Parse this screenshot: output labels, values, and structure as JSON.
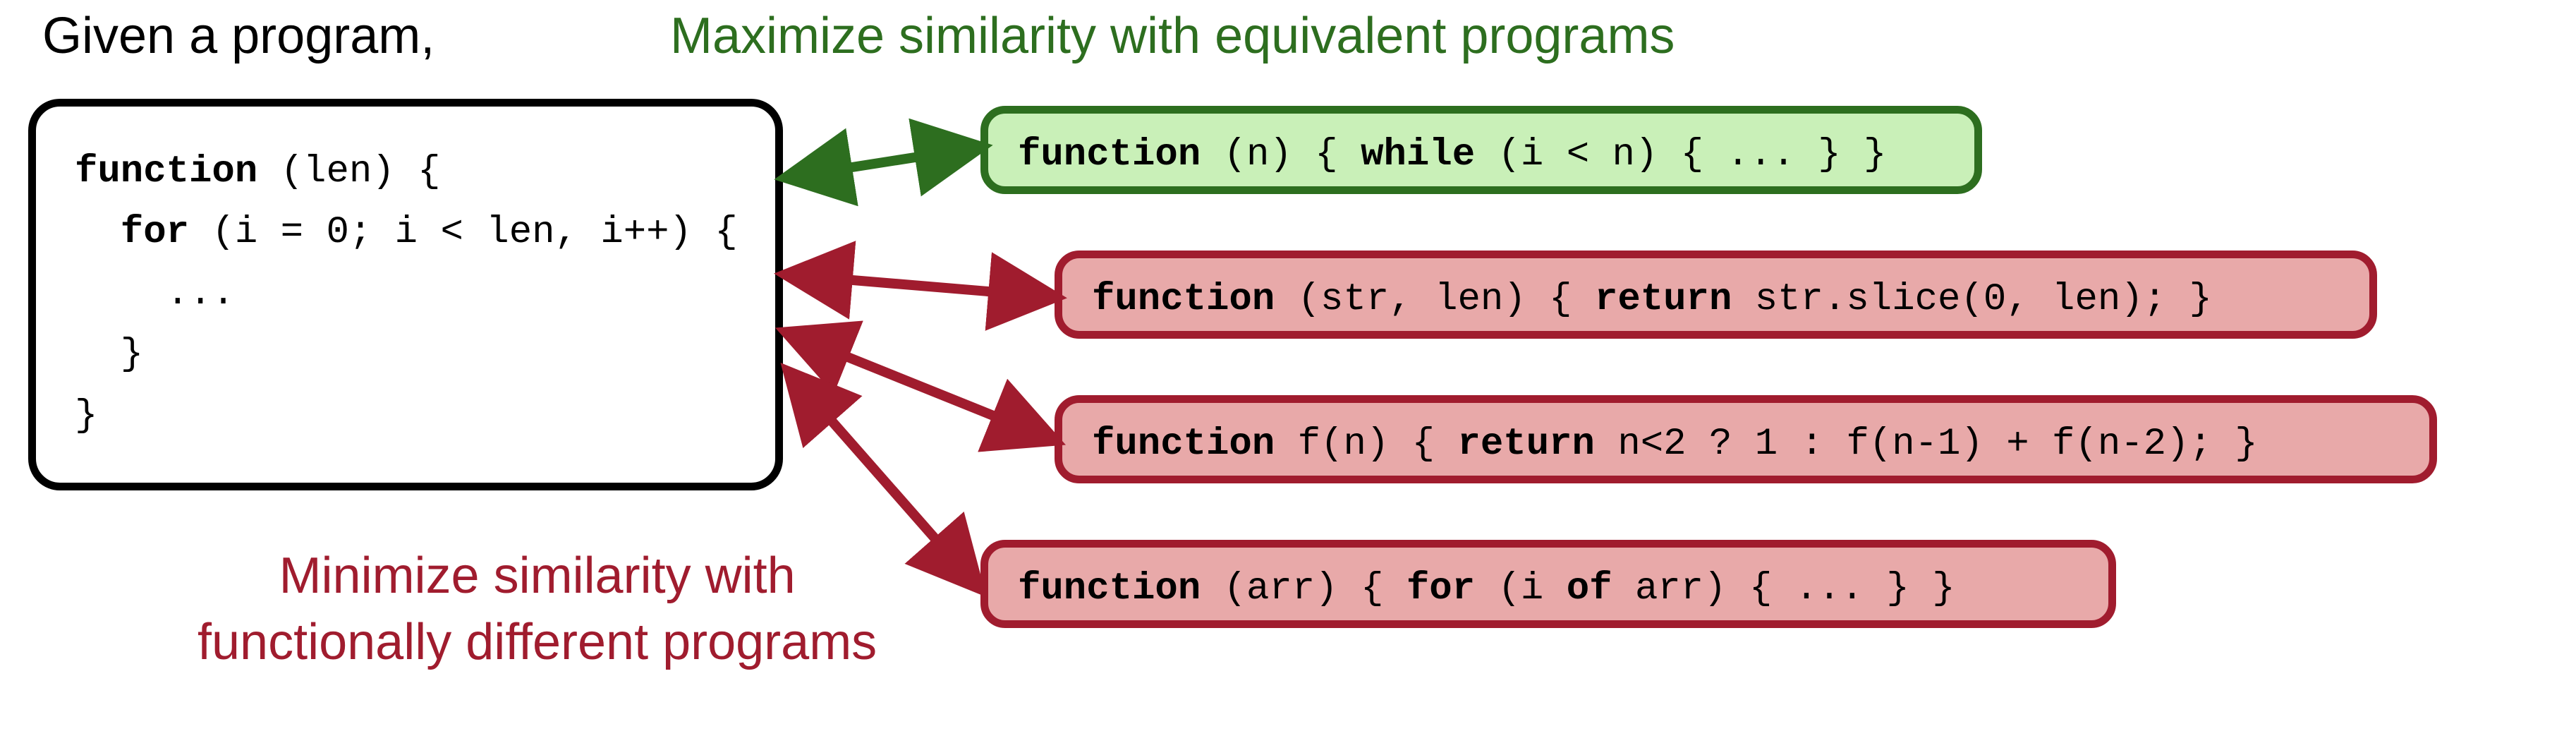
{
  "headings": {
    "given": "Given a program,",
    "maximize": "Maximize similarity with equivalent programs",
    "minimize_line1": "Minimize similarity with",
    "minimize_line2": "functionally different programs"
  },
  "source": {
    "line1_pre": "function",
    "line1_post": " (len) {",
    "line2_pre": "  for",
    "line2_post": " (i = 0; i < len, i++) {",
    "line3": "    ...",
    "line4": "  }",
    "line5": "}"
  },
  "equivalent": {
    "kw1": "function",
    "seg1": " (n) { ",
    "kw2": "while",
    "seg2": " (i < n) { ... } }"
  },
  "different": [
    {
      "kw1": "function",
      "seg1": " (str, len) { ",
      "kw2": "return",
      "seg2": " str.slice(0, len); }"
    },
    {
      "kw1": "function",
      "seg1": " f(n) { ",
      "kw2": "return",
      "seg2": " n<2 ? 1 : f(n-1) + f(n-2); }"
    },
    {
      "kw1": "function",
      "seg1": " (arr) { ",
      "kw2": "for",
      "seg2": " (i ",
      "kw3": "of",
      "seg3": " arr) { ... } }"
    }
  ],
  "colors": {
    "green": "#2d6e1f",
    "red": "#a01c2e",
    "green_fill": "#c9f0b8",
    "red_fill": "#e8a9a9"
  }
}
